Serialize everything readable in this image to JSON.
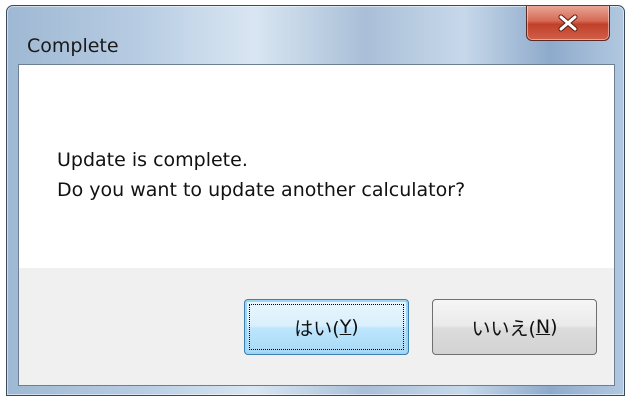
{
  "window": {
    "title": "Complete"
  },
  "title_bar": {
    "close_icon": "close-icon",
    "close_label": "x"
  },
  "message": {
    "line1": "Update is complete.",
    "line2": "Do you want to update another calculator?"
  },
  "buttons": {
    "yes": {
      "label_prefix": "はい(",
      "mnemonic": "Y",
      "label_suffix": ")"
    },
    "no": {
      "label_prefix": "いいえ(",
      "mnemonic": "N",
      "label_suffix": ")"
    }
  },
  "colors": {
    "close_button": "#c1402a",
    "default_button_border": "#3c7fb1",
    "footer_background": "#f0f0f0"
  }
}
